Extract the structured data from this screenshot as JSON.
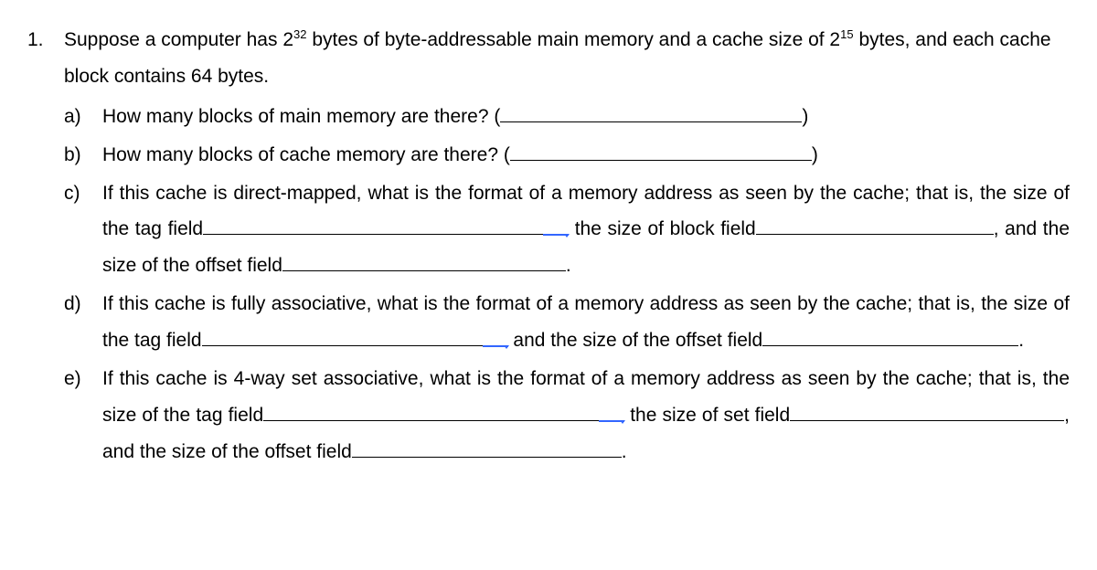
{
  "problem_number": "1.",
  "intro_part1": "Suppose a computer has  2",
  "intro_sup1": "32",
  "intro_part2": " bytes of byte-addressable main memory and a cache size of  2",
  "intro_sup2": "15",
  "intro_part3": " bytes, and each cache block contains 64 bytes.",
  "parts": {
    "a": {
      "label": "a)",
      "text1": "How many blocks of main memory are there? (",
      "text2": ")"
    },
    "b": {
      "label": "b)",
      "text1": "How many blocks of cache memory are there? (",
      "text2": ")"
    },
    "c": {
      "label": "c)",
      "text1": "If this cache is direct-mapped, what is the format of a memory address as seen by the cache; that is, the size of the tag field",
      "text2": " the size of block field",
      "text3": ", and the size of the offset field",
      "text4": "."
    },
    "d": {
      "label": "d)",
      "text1": "If this cache is fully associative, what is the format of a memory address as seen by the cache; that is, the size of the tag field",
      "text2": " and the size of the offset field",
      "text3": "."
    },
    "e": {
      "label": "e)",
      "text1": "If this cache is 4-way set associative, what is the format of a memory address as seen by the cache; that is, the size of the tag field",
      "text2": " the size of set field",
      "text3": ", and the size of the offset field",
      "text4": "."
    }
  }
}
